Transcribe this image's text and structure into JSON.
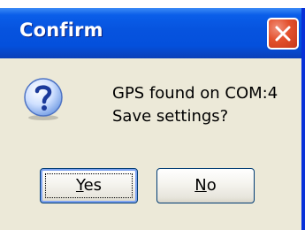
{
  "window": {
    "title": "Confirm"
  },
  "message": {
    "line1": "GPS found on COM:4",
    "line2": "Save settings?",
    "icon": "question-icon"
  },
  "buttons": {
    "yes": {
      "mnemonic": "Y",
      "rest": "es"
    },
    "no": {
      "mnemonic": "N",
      "rest": "o"
    }
  },
  "colors": {
    "titlebar": "#0653de",
    "close_button": "#e3502c",
    "dialog_face": "#ece9d8",
    "frame_border": "#0831d9"
  }
}
